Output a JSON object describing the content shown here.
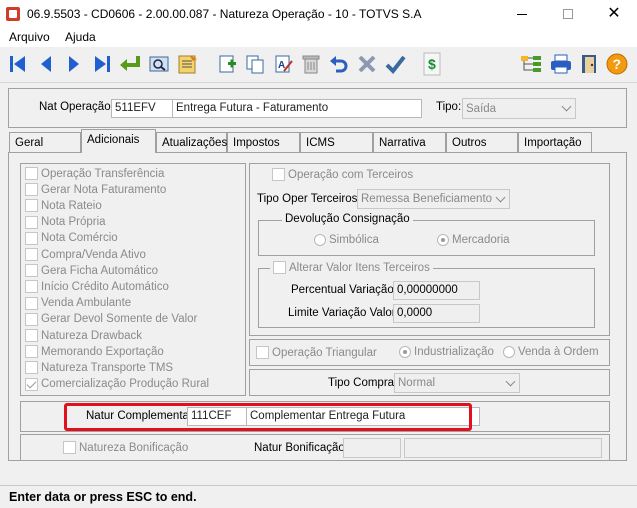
{
  "window": {
    "title": "06.9.5503 - CD0606 - 2.00.00.087 - Natureza Operação - 10 - TOTVS S.A",
    "min_label": "",
    "close_label": "✕"
  },
  "menu": {
    "items": [
      "Arquivo",
      "Ajuda"
    ]
  },
  "toolbar": {
    "icons": [
      "first-record-icon",
      "prev-record-icon",
      "next-record-icon",
      "last-record-icon",
      "goto-icon",
      "search-icon",
      "list-icon",
      "add-icon",
      "copy-icon",
      "edit-icon",
      "delete-icon",
      "undo-icon",
      "cancel-icon",
      "confirm-icon",
      "currency-icon",
      "tree-icon",
      "print-icon",
      "exit-icon",
      "help-icon"
    ],
    "currency_glyph": "$",
    "help_glyph": "?"
  },
  "header": {
    "nat_label": "Nat Operação:",
    "nat_code": "511EFV",
    "nat_desc": "Entrega Futura - Faturamento",
    "tipo_label": "Tipo:",
    "tipo_value": "Saída"
  },
  "tabs": [
    "Geral",
    "Adicionais",
    "Atualizações",
    "Impostos",
    "ICMS",
    "Narrativa",
    "Outros",
    "Importação"
  ],
  "left_checks": [
    {
      "label": "Operação Transferência",
      "checked": false
    },
    {
      "label": "Gerar Nota Faturamento",
      "checked": false
    },
    {
      "label": "Nota Rateio",
      "checked": false
    },
    {
      "label": "Nota Própria",
      "checked": false
    },
    {
      "label": "Nota Comércio",
      "checked": false
    },
    {
      "label": "Compra/Venda Ativo",
      "checked": false
    },
    {
      "label": "Gera Ficha Automático",
      "checked": false
    },
    {
      "label": "Início Crédito Automático",
      "checked": false
    },
    {
      "label": "Venda Ambulante",
      "checked": false
    },
    {
      "label": "Gerar Devol Somente de Valor",
      "checked": false
    },
    {
      "label": "Natureza Drawback",
      "checked": false
    },
    {
      "label": "Memorando Exportação",
      "checked": false
    },
    {
      "label": "Natureza Transporte TMS",
      "checked": false
    },
    {
      "label": "Comercialização Produção Rural",
      "checked": true
    }
  ],
  "terceiros": {
    "op_label": "Operação com Terceiros",
    "tipo_label": "Tipo Oper Terceiros:",
    "tipo_value": "Remessa Beneficiamento",
    "devol_title": "Devolução Consignação",
    "radio_simbolica": "Simbólica",
    "radio_mercadoria": "Mercadoria",
    "alterar_label": "Alterar Valor Itens Terceiros",
    "perc_label": "Percentual Variação:",
    "perc_value": "0,00000000",
    "limite_label": "Limite Variação Valor:",
    "limite_value": "0,0000"
  },
  "triangular": {
    "label": "Operação Triangular",
    "radio_ind": "Industrialização",
    "radio_venda": "Venda à Ordem"
  },
  "compra": {
    "label": "Tipo Compra:",
    "value": "Normal"
  },
  "complementar": {
    "label": "Natur Complementar:",
    "code": "111CEF",
    "desc": "Complementar Entrega Futura"
  },
  "bonificacao": {
    "check_label": "Natureza Bonificação",
    "field_label": "Natur Bonificação:"
  },
  "status": {
    "text": "Enter data or press ESC to end."
  },
  "colors": {
    "highlight": "#e0101e",
    "nav_blue": "#1f5fcf"
  }
}
